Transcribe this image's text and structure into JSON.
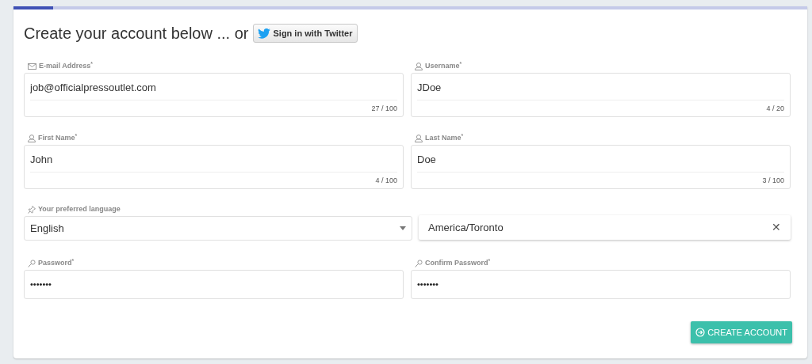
{
  "progress": {
    "level": 0.05
  },
  "heading": "Create your account below ... or",
  "twitter_button": "Sign in with Twitter",
  "fields": [
    {
      "kind": "email",
      "label": "E-mail Address$^{*}$",
      "value": "job@officialpressoutlet.com",
      "counter": "27 / 100"
    },
    {
      "kind": "text",
      "label": "Username$^{*}$",
      "value": "JDoe",
      "counter": "4 / 20"
    },
    {
      "kind": "text",
      "label": "First Name$^{*}$",
      "value": "John",
      "counter": "4 / 100"
    },
    {
      "kind": "text",
      "label": "Last Name$^{*}$",
      "value": "Doe",
      "counter": "3 / 100"
    },
    {
      "kind": "select",
      "label": "Your preferred language",
      "value": "English"
    },
    {
      "kind": "autocomplete",
      "value": "America/Toronto",
      "clear": "✕"
    },
    {
      "kind": "password",
      "label": "Password$^{*}$",
      "value": "•••••••"
    },
    {
      "kind": "password",
      "label": "Confirm Password$^{*}$",
      "value": "•••••••"
    }
  ],
  "submit_button": "CREATE ACCOUNT"
}
